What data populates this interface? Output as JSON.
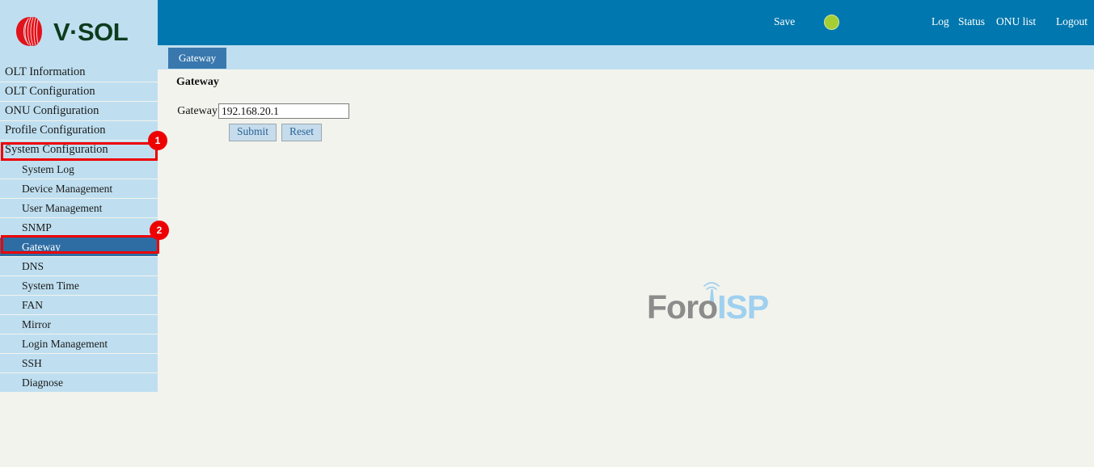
{
  "brand": {
    "logo_text": "V·SOL",
    "logo_icon": "vsol-swirl-logo"
  },
  "header": {
    "save_label": "Save",
    "status_dot": {
      "name": "save-status-indicator",
      "color": "#a5ce34"
    },
    "links": [
      {
        "label": "Log",
        "name": "log"
      },
      {
        "label": "Status",
        "name": "status"
      },
      {
        "label": "ONU list",
        "name": "onu-list"
      },
      {
        "label": "Logout",
        "name": "logout"
      }
    ]
  },
  "tabs": [
    {
      "label": "Gateway",
      "active": true
    }
  ],
  "sidebar": {
    "items": [
      {
        "label": "OLT Information",
        "level": "main",
        "selected": false
      },
      {
        "label": "OLT Configuration",
        "level": "main",
        "selected": false
      },
      {
        "label": "ONU Configuration",
        "level": "main",
        "selected": false
      },
      {
        "label": "Profile Configuration",
        "level": "main",
        "selected": false
      },
      {
        "label": "System Configuration",
        "level": "main",
        "selected": false
      },
      {
        "label": "System Log",
        "level": "sub",
        "selected": false
      },
      {
        "label": "Device Management",
        "level": "sub",
        "selected": false
      },
      {
        "label": "User Management",
        "level": "sub",
        "selected": false
      },
      {
        "label": "SNMP",
        "level": "sub",
        "selected": false
      },
      {
        "label": "Gateway",
        "level": "sub",
        "selected": true
      },
      {
        "label": "DNS",
        "level": "sub",
        "selected": false
      },
      {
        "label": "System Time",
        "level": "sub",
        "selected": false
      },
      {
        "label": "FAN",
        "level": "sub",
        "selected": false
      },
      {
        "label": "Mirror",
        "level": "sub",
        "selected": false
      },
      {
        "label": "Login Management",
        "level": "sub",
        "selected": false
      },
      {
        "label": "SSH",
        "level": "sub",
        "selected": false
      },
      {
        "label": "Diagnose",
        "level": "sub",
        "selected": false
      }
    ]
  },
  "annotations": [
    {
      "number": "1",
      "target": "System Configuration"
    },
    {
      "number": "2",
      "target": "Gateway"
    }
  ],
  "main": {
    "section_title": "Gateway",
    "form": {
      "label": "Gateway",
      "value": "192.168.20.1",
      "placeholder": ""
    },
    "buttons": {
      "submit": "Submit",
      "reset": "Reset"
    }
  },
  "watermark": {
    "part1": "Foro",
    "part2": "ISP",
    "icon": "antenna-tower-icon"
  },
  "colors": {
    "header_blue": "#0077ae",
    "sidebar_blue": "#bfdff0",
    "selected_blue": "#2e6da4",
    "tab_blue": "#3878ae",
    "annotation_red": "#ee0000",
    "page_background": "#f2f3ed"
  }
}
